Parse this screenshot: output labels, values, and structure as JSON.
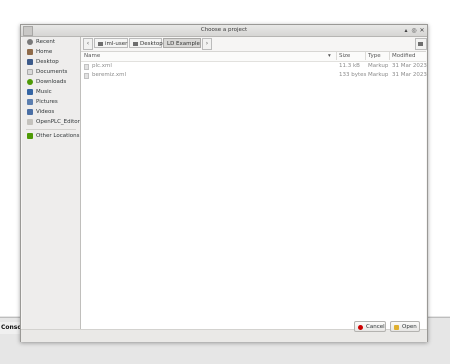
{
  "window": {
    "title": "Choose a project",
    "controls": [
      "▴",
      "◎",
      "✕"
    ]
  },
  "sidebar": {
    "items": [
      {
        "label": "Recent",
        "icon": "clock-icon",
        "color": "#7a7a7a"
      },
      {
        "label": "Home",
        "icon": "home-icon",
        "color": "#8f6b4a"
      },
      {
        "label": "Desktop",
        "icon": "desktop-icon",
        "color": "#3c5a8a"
      },
      {
        "label": "Documents",
        "icon": "documents-icon",
        "color": "#c8c8c8"
      },
      {
        "label": "Downloads",
        "icon": "downloads-icon",
        "color": "#4e9a06"
      },
      {
        "label": "Music",
        "icon": "music-icon",
        "color": "#3465a4"
      },
      {
        "label": "Pictures",
        "icon": "pictures-icon",
        "color": "#5c7fb0"
      },
      {
        "label": "Videos",
        "icon": "videos-icon",
        "color": "#4a6fa5"
      },
      {
        "label": "OpenPLC_Editor",
        "icon": "folder-icon",
        "color": "#c4c2bd"
      },
      {
        "label": "Other Locations",
        "icon": "plus-icon",
        "color": "#4e9a06"
      }
    ]
  },
  "pathbar": {
    "back": "‹",
    "forward": "›",
    "crumbs": [
      "iml-user",
      "Desktop",
      "LD Example"
    ]
  },
  "files": {
    "headers": {
      "name": "Name",
      "size": "Size",
      "type": "Type",
      "modified": "Modified"
    },
    "sort_indicator": "▾",
    "rows": [
      {
        "name": "plc.xml",
        "size": "11.3 kB",
        "type": "Markup",
        "modified": "31 Mar 2023"
      },
      {
        "name": "beremiz.xml",
        "size": "133 bytes",
        "type": "Markup",
        "modified": "31 Mar 2023"
      }
    ]
  },
  "buttons": {
    "cancel": "Cancel",
    "open": "Open"
  },
  "background": {
    "console_tab": "Conso"
  },
  "colors": {
    "cancel_icon": "#cc0000",
    "open_icon": "#e0b030"
  }
}
